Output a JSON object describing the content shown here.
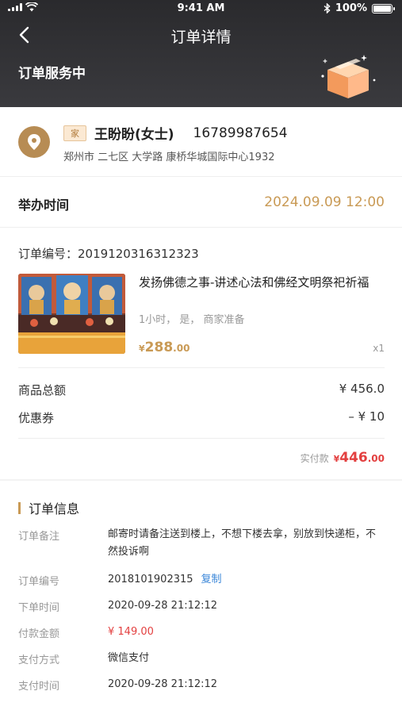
{
  "status_bar": {
    "time": "9:41 AM",
    "battery": "100%"
  },
  "nav": {
    "title": "订单详情"
  },
  "header": {
    "status_text": "订单服务中"
  },
  "address": {
    "tag": "家",
    "name": "王盼盼(女士)",
    "phone": "16789987654",
    "full_address": "郑州市 二七区 大学路 康桥华城国际中心1932"
  },
  "hold_time": {
    "label": "举办时间",
    "value": "2024.09.09 12:00"
  },
  "order": {
    "number_label": "订单编号：",
    "number": "2019120316312323",
    "product": {
      "title": "发扬佛德之事-讲述心法和佛经文明祭祀祈福",
      "desc": "1小时， 是， 商家准备",
      "price_currency": "¥",
      "price_int": "288",
      "price_dec": ".00",
      "qty": "x1"
    },
    "subtotal_label": "商品总额",
    "subtotal_value": "¥ 456.0",
    "coupon_label": "优惠券",
    "coupon_value": "– ¥ 10",
    "paid_label": "实付款",
    "paid_currency": "¥",
    "paid_int": "446",
    "paid_dec": ".00"
  },
  "order_info": {
    "title": "订单信息",
    "rows": [
      {
        "label": "订单备注",
        "value": "邮寄时请备注送到楼上，不想下楼去拿，别放到快递柜，不然投诉啊"
      },
      {
        "label": "订单编号",
        "value": "2018101902315",
        "action": "复制"
      },
      {
        "label": "下单时间",
        "value": "2020-09-28 21:12:12"
      },
      {
        "label": "付款金额",
        "value": "¥ 149.00"
      },
      {
        "label": "支付方式",
        "value": "微信支付"
      },
      {
        "label": "支付时间",
        "value": "2020-09-28 21:12:12"
      }
    ]
  },
  "colors": {
    "accent": "#c99a55",
    "price_red": "#e34040",
    "link": "#3a86d8",
    "header_bg": "#2a2a2d"
  }
}
